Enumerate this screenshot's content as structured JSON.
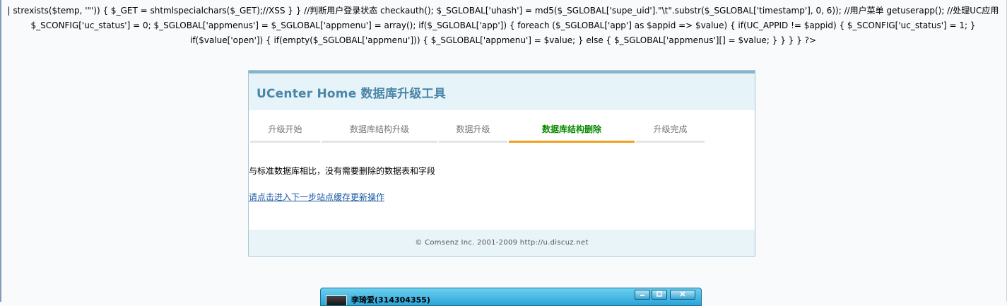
{
  "leaked_code": "| strexists($temp, '\"')) { $_GET = shtmlspecialchars($_GET);//XSS } } //判断用户登录状态 checkauth(); $_SGLOBAL['uhash'] = md5($_SGLOBAL['supe_uid'].\"\\t\".substr($_SGLOBAL['timestamp'], 0, 6)); //用户菜单 getuserapp(); //处理UC应用 $_SCONFIG['uc_status'] = 0; $_SGLOBAL['appmenus'] = $_SGLOBAL['appmenu'] = array(); if($_SGLOBAL['app']) { foreach ($_SGLOBAL['app'] as $appid => $value) { if(UC_APPID != $appid) { $_SCONFIG['uc_status'] = 1; } if($value['open']) { if(empty($_SGLOBAL['appmenu'])) { $_SGLOBAL['appmenu'] = $value; } else { $_SGLOBAL['appmenus'][] = $value; } } } } ?>",
  "header": {
    "title": "UCenter Home 数据库升级工具"
  },
  "steps": [
    {
      "label": "升级开始",
      "active": false
    },
    {
      "label": "数据库结构升级",
      "active": false
    },
    {
      "label": "数据升级",
      "active": false
    },
    {
      "label": "数据库结构删除",
      "active": true
    },
    {
      "label": "升级完成",
      "active": false
    }
  ],
  "content": {
    "message": "与标准数据库相比，没有需要删除的数据表和字段",
    "next_link": "请点击进入下一步站点缓存更新操作"
  },
  "footer": {
    "text": "© Comsenz Inc. 2001-2009 http://u.discuz.net"
  },
  "chat_window": {
    "title": "李琦爱(314304355)",
    "minimize_icon": "minimize-icon",
    "maximize_icon": "maximize-icon",
    "close_icon": "close-icon"
  },
  "colors": {
    "title": "#4a86a8",
    "active_step": "#0a8a00",
    "active_underline": "#f0a020",
    "link": "#1c5aa3"
  }
}
